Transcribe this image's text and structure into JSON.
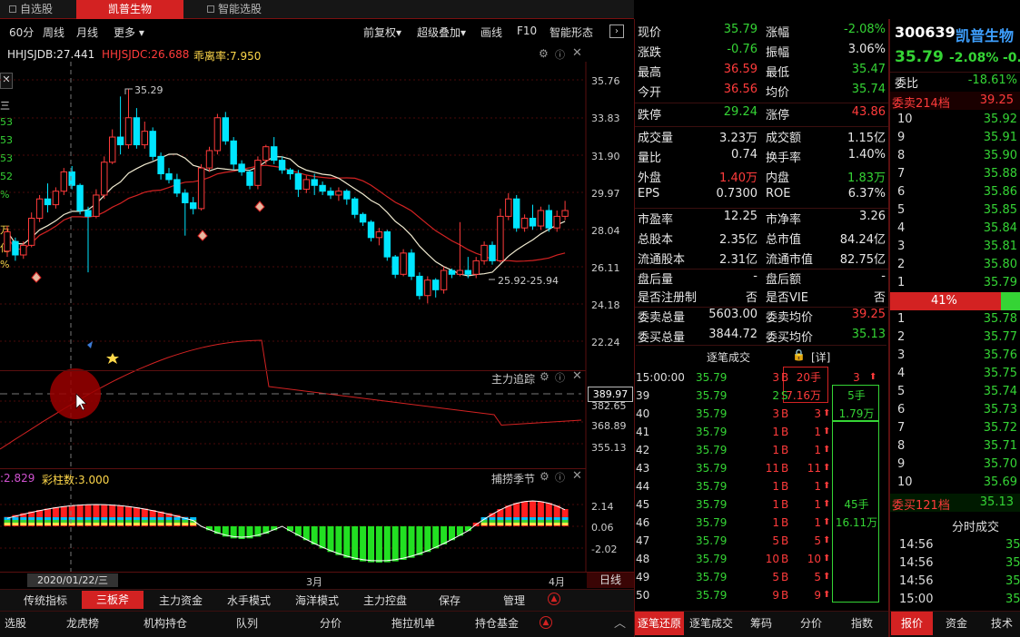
{
  "tabs": [
    "自选股",
    "凯普生物",
    "智能选股"
  ],
  "toolbar": {
    "left": [
      "60分",
      "周线",
      "月线",
      "更多"
    ],
    "right": [
      "前复权",
      "超级叠加",
      "画线",
      "F10",
      "智能形态"
    ]
  },
  "legend": {
    "jdb": "HHJSJDB:27.441",
    "jdc": "HHJSJDC:26.688",
    "gll": "乖离率:7.950"
  },
  "main_chart": {
    "high_label": "35.29",
    "range_label": "25.92-25.94",
    "yaxis": [
      "35.76",
      "33.83",
      "31.90",
      "29.97",
      "28.04",
      "26.11",
      "24.18",
      "22.24"
    ],
    "left_glyphs": [
      "三",
      "53",
      "53",
      "53",
      "52",
      "%",
      "万",
      "亿",
      "%"
    ]
  },
  "sub1": {
    "title": "主力追踪",
    "highlight": "389.97",
    "yaxis": [
      "382.65",
      "368.89",
      "355.13"
    ]
  },
  "sub2": {
    "legend1": ":2.829",
    "legend2": "彩柱数:3.000",
    "title": "捕捞季节",
    "yaxis": [
      "2.14",
      "0.06",
      "-2.02"
    ]
  },
  "date_axis": {
    "cursor_date": "2020/01/22/三",
    "m3": "3月",
    "m4": "4月",
    "period": "日线"
  },
  "indicator_bar": [
    "传统指标",
    "三板斧",
    "主力资金",
    "水手模式",
    "海洋模式",
    "主力控盘",
    "保存",
    "管理"
  ],
  "bottom_left": [
    "选股",
    "龙虎榜",
    "机构持仓",
    "队列",
    "分价",
    "拖拉机单",
    "持仓基金"
  ],
  "quote": {
    "rows": [
      [
        "现价",
        "35.79",
        "g",
        "涨幅",
        "-2.08%",
        "g"
      ],
      [
        "涨跌",
        "-0.76",
        "g",
        "振幅",
        "3.06%",
        "w"
      ],
      [
        "最高",
        "36.59",
        "r",
        "最低",
        "35.47",
        "g"
      ],
      [
        "今开",
        "36.56",
        "r",
        "均价",
        "35.74",
        "g"
      ],
      [
        "跌停",
        "29.24",
        "g",
        "涨停",
        "43.86",
        "r"
      ],
      [
        "成交量",
        "3.23万",
        "w",
        "成交额",
        "1.15亿",
        "w"
      ],
      [
        "量比",
        "0.74",
        "w",
        "换手率",
        "1.40%",
        "w"
      ],
      [
        "外盘",
        "1.40万",
        "r",
        "内盘",
        "1.83万",
        "g"
      ],
      [
        "EPS",
        "0.7300",
        "w",
        "ROE",
        "6.37%",
        "w"
      ],
      [
        "市盈率",
        "12.25",
        "w",
        "市净率",
        "3.26",
        "w"
      ],
      [
        "总股本",
        "2.35亿",
        "w",
        "总市值",
        "84.24亿",
        "w"
      ],
      [
        "流通股本",
        "2.31亿",
        "w",
        "流通市值",
        "82.75亿",
        "w"
      ],
      [
        "盘后量",
        "-",
        "w",
        "盘后额",
        "-",
        "w"
      ],
      [
        "是否注册制",
        "否",
        "w",
        "是否VIE",
        "否",
        "w"
      ],
      [
        "委卖总量",
        "5603.00",
        "w",
        "委卖均价",
        "39.25",
        "r"
      ],
      [
        "委买总量",
        "3844.72",
        "w",
        "委买均价",
        "35.13",
        "g"
      ]
    ]
  },
  "trades": {
    "title": "逐笔成交",
    "detail": "[详]",
    "rows": [
      [
        "15:00:00",
        "35.79",
        "3",
        "B",
        "20手",
        "3"
      ],
      [
        "39",
        "35.79",
        "2",
        "S",
        "7.16万",
        "5手"
      ],
      [
        "40",
        "35.79",
        "3",
        "B",
        "3",
        "1.79万"
      ],
      [
        "41",
        "35.79",
        "1",
        "B",
        "1",
        ""
      ],
      [
        "42",
        "35.79",
        "1",
        "B",
        "1",
        ""
      ],
      [
        "43",
        "35.79",
        "11",
        "B",
        "11",
        ""
      ],
      [
        "44",
        "35.79",
        "1",
        "B",
        "1",
        ""
      ],
      [
        "45",
        "35.79",
        "1",
        "B",
        "1",
        "45手"
      ],
      [
        "46",
        "35.79",
        "1",
        "B",
        "1",
        "16.11万"
      ],
      [
        "47",
        "35.79",
        "5",
        "B",
        "5",
        ""
      ],
      [
        "48",
        "35.79",
        "10",
        "B",
        "10",
        ""
      ],
      [
        "49",
        "35.79",
        "5",
        "B",
        "5",
        ""
      ],
      [
        "50",
        "35.79",
        "9",
        "B",
        "9",
        ""
      ]
    ]
  },
  "trade_tabs": [
    "逐笔还原",
    "逐笔成交",
    "筹码",
    "分价",
    "指数"
  ],
  "stock": {
    "code": "300639",
    "name": "凯普生物",
    "price": "35.79",
    "change_pct": "-2.08%",
    "change": "-0.",
    "wb_label": "委比",
    "wb_value": "-18.61%",
    "sell_title": "委卖214档",
    "sell_avg": "39.25",
    "buy_title": "委买121档",
    "buy_avg": "35.13",
    "ratio": "41%"
  },
  "sell_book": [
    [
      "10",
      "35.92"
    ],
    [
      "9",
      "35.91"
    ],
    [
      "8",
      "35.90"
    ],
    [
      "7",
      "35.88"
    ],
    [
      "6",
      "35.86"
    ],
    [
      "5",
      "35.85"
    ],
    [
      "4",
      "35.84"
    ],
    [
      "3",
      "35.81"
    ],
    [
      "2",
      "35.80"
    ],
    [
      "1",
      "35.79"
    ]
  ],
  "buy_book": [
    [
      "1",
      "35.78"
    ],
    [
      "2",
      "35.77"
    ],
    [
      "3",
      "35.76"
    ],
    [
      "4",
      "35.75"
    ],
    [
      "5",
      "35.74"
    ],
    [
      "6",
      "35.73"
    ],
    [
      "7",
      "35.72"
    ],
    [
      "8",
      "35.71"
    ],
    [
      "9",
      "35.70"
    ],
    [
      "10",
      "35.69"
    ]
  ],
  "fenshi": {
    "title": "分时成交",
    "rows": [
      [
        "14:56",
        "35"
      ],
      [
        "14:56",
        "35"
      ],
      [
        "14:56",
        "35"
      ],
      [
        "15:00",
        "35"
      ]
    ]
  },
  "right_tabs": [
    "报价",
    "资金",
    "技术"
  ],
  "colors": {
    "up": "#ff3b3b",
    "down": "#00e5ff",
    "accent": "#d32222",
    "green": "#35d435"
  }
}
